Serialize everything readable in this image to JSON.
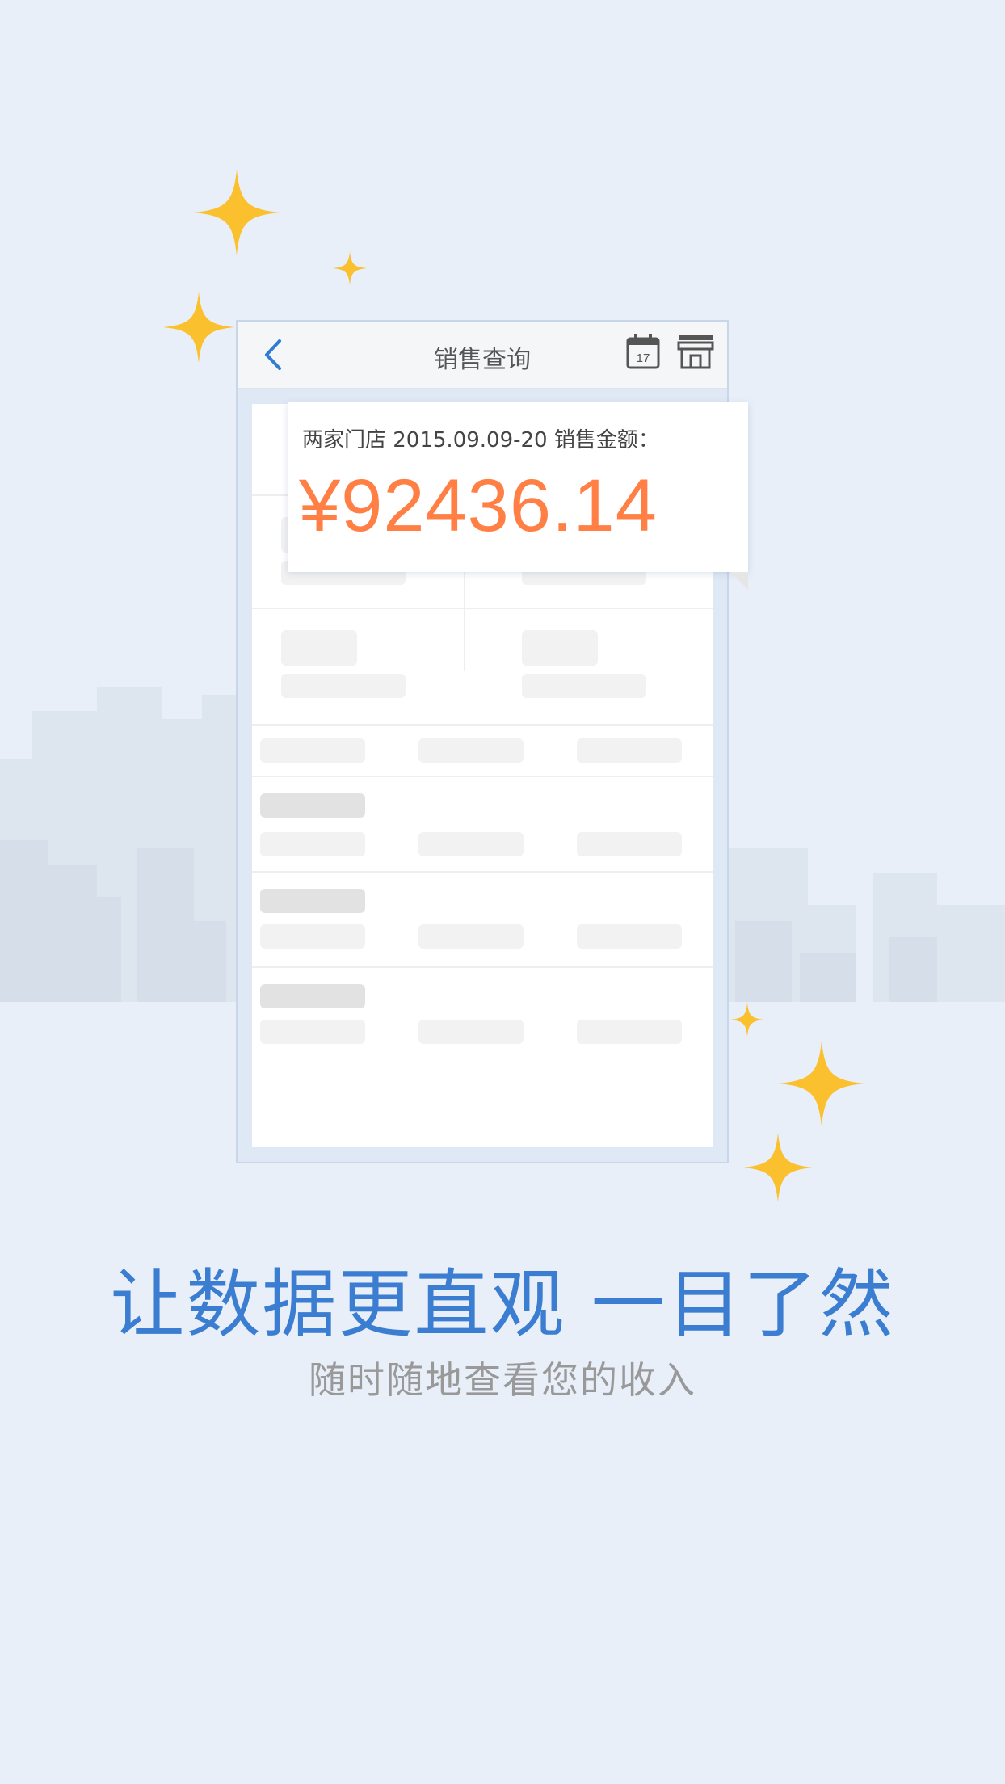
{
  "colors": {
    "background": "#e8eff9",
    "headline": "#3b7dd0",
    "amount": "#ff7f45",
    "sparkle": "#fbc02d"
  },
  "icons": {
    "back": "chevron-left-icon",
    "calendar": "calendar-icon",
    "store": "store-icon",
    "sparkle": "sparkle-star-icon"
  },
  "phone": {
    "title": "销售查询",
    "calendar_day": "17"
  },
  "summary": {
    "label": "两家门店 2015.09.09-20 销售金额：",
    "amount": "¥92436.14"
  },
  "headline": "让数据更直观  一目了然",
  "subline": "随时随地查看您的收入"
}
